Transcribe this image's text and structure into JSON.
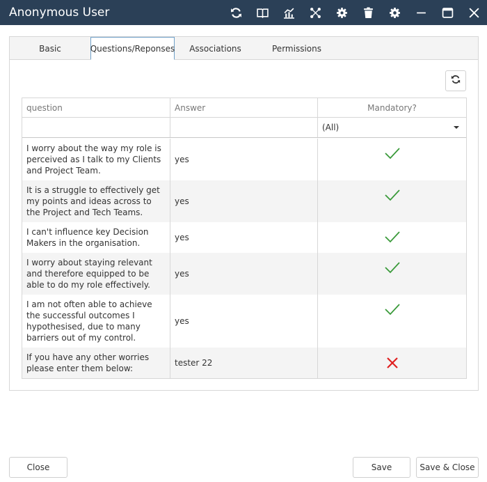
{
  "window": {
    "title": "Anonymous User",
    "toolbar_icons": [
      "refresh-icon",
      "book-icon",
      "chart-icon",
      "network-icon",
      "settings-cog-icon",
      "trash-icon",
      "gear-icon",
      "minimize-icon",
      "maximize-icon",
      "close-icon"
    ]
  },
  "tabs": [
    {
      "label": "Basic"
    },
    {
      "label": "Questions/Reponses",
      "active": true
    },
    {
      "label": "Associations"
    },
    {
      "label": "Permissions"
    }
  ],
  "grid": {
    "columns": [
      "question",
      "Answer",
      "Mandatory?"
    ],
    "filter": {
      "mandatory_value": "(All)"
    },
    "rows": [
      {
        "question": "I worry about the way my role is perceived as I talk to my Clients and Project Team.",
        "answer": "yes",
        "mandatory": true
      },
      {
        "question": "It is a struggle to effectively get my points and ideas across to the Project and Tech Teams.",
        "answer": "yes",
        "mandatory": true
      },
      {
        "question": "I can't influence key Decision Makers in the organisation.",
        "answer": "yes",
        "mandatory": true
      },
      {
        "question": "I worry about staying relevant and therefore equipped to be able to do my role effectively.",
        "answer": "yes",
        "mandatory": true
      },
      {
        "question": "I am not often able to achieve the successful outcomes I hypothesised, due to many barriers out of my control.",
        "answer": "yes",
        "mandatory": true
      },
      {
        "question": "If you have any other worries please enter them below:",
        "answer": "tester 22",
        "mandatory": false
      }
    ]
  },
  "footer": {
    "close_label": "Close",
    "save_label": "Save",
    "save_close_label": "Save & Close"
  },
  "colors": {
    "titlebar": "#2b4057",
    "check": "#3a9a3a",
    "cross": "#e02020"
  }
}
